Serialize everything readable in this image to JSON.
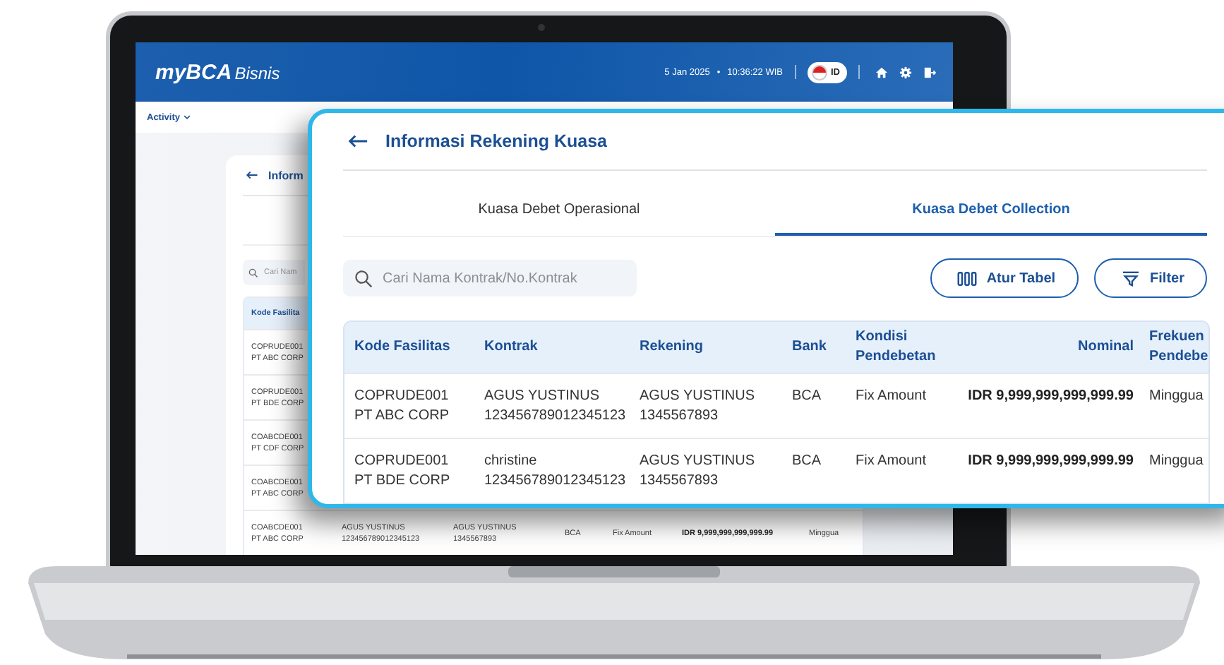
{
  "screen": {
    "header": {
      "logo_brand": "myBCA",
      "logo_suffix": "Bisnis",
      "date": "5 Jan 2025",
      "separator": "•",
      "time": "10:36:22 WIB",
      "language": "ID"
    },
    "nav": {
      "menu": "Activity"
    },
    "page": {
      "title": "Inform",
      "search": {
        "placeholder": "Cari Nam"
      },
      "table": {
        "columns": [
          "Kode Fasilita"
        ],
        "rows": [
          {
            "cells": [
              [
                "COPRUDE001",
                "PT ABC CORP"
              ]
            ]
          },
          {
            "cells": [
              [
                "COPRUDE001",
                "PT BDE CORP"
              ]
            ]
          },
          {
            "cells": [
              [
                "COABCDE001",
                "PT CDF CORP"
              ]
            ]
          },
          {
            "cells": [
              [
                "COABCDE001",
                "PT ABC CORP"
              ]
            ]
          },
          {
            "cells": [
              [
                "COABCDE001",
                "PT ABC CORP"
              ],
              [
                "AGUS YUSTINUS",
                "123456789012345123"
              ],
              [
                "AGUS YUSTINUS",
                "1345567893"
              ],
              [
                "BCA"
              ],
              [
                "Fix Amount"
              ],
              [
                "IDR 9,999,999,999,999.99"
              ],
              [
                "Minggua"
              ]
            ]
          }
        ]
      }
    }
  },
  "panel": {
    "title": "Informasi Rekening Kuasa",
    "tabs": [
      {
        "label": "Kuasa Debet Operasional",
        "selected": false
      },
      {
        "label": "Kuasa Debet Collection",
        "selected": true
      }
    ],
    "search": {
      "placeholder": "Cari Nama Kontrak/No.Kontrak"
    },
    "buttons": [
      {
        "kind": "columns",
        "label": "Atur Tabel"
      },
      {
        "kind": "filter",
        "label": "Filter"
      }
    ],
    "table": {
      "columns": [
        {
          "label": "Kode Fasilitas",
          "kind": "text"
        },
        {
          "label": "Kontrak",
          "kind": "text"
        },
        {
          "label": "Rekening",
          "kind": "text"
        },
        {
          "label": "Bank",
          "kind": "text"
        },
        {
          "label": "Kondisi Pendebetan",
          "kind": "text"
        },
        {
          "label": "Nominal",
          "kind": "amount"
        },
        {
          "label": "Frekuen Pendebe",
          "kind": "text"
        }
      ],
      "rows": [
        {
          "cells": [
            [
              "COPRUDE001",
              "PT ABC CORP"
            ],
            [
              "AGUS YUSTINUS",
              "123456789012345123"
            ],
            [
              "AGUS YUSTINUS",
              "1345567893"
            ],
            [
              "BCA"
            ],
            [
              "Fix Amount"
            ],
            [
              "IDR 9,999,999,999,999.99"
            ],
            [
              "Minggua"
            ]
          ]
        },
        {
          "cells": [
            [
              "COPRUDE001",
              "PT BDE CORP"
            ],
            [
              "christine",
              "123456789012345123"
            ],
            [
              "AGUS YUSTINUS",
              "1345567893"
            ],
            [
              "BCA"
            ],
            [
              "Fix Amount"
            ],
            [
              "IDR 9,999,999,999,999.99"
            ],
            [
              "Minggua"
            ]
          ]
        }
      ]
    }
  }
}
